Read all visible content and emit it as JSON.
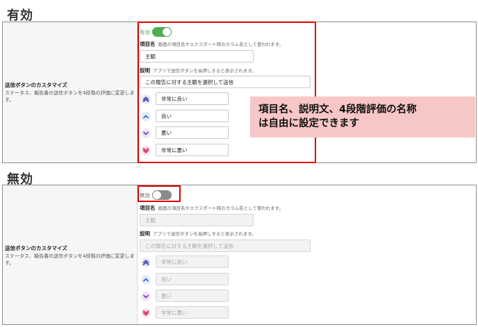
{
  "sections": {
    "enabled": {
      "heading": "有効"
    },
    "disabled": {
      "heading": "無効"
    }
  },
  "setting": {
    "title": "送信ボタンのカスタマイズ",
    "description": "ステータス、報告書の送信ボタンを4段階の評価に変更します。"
  },
  "toggle": {
    "on_label": "有効",
    "off_label": "無効"
  },
  "item_name": {
    "label": "項目名",
    "hint": "画面の項目名やエクスポート時のカラム名として使われます。",
    "value": "主観"
  },
  "explanation": {
    "label": "説明",
    "hint": "アプリで送信ボタンを長押しすると表示されます。",
    "value": "この報告に対する主観を選択して送信"
  },
  "ranks": [
    {
      "icon": "double-chevron-up-icon",
      "label": "非常に良い",
      "color": "#3f4fb0"
    },
    {
      "icon": "chevron-up-icon",
      "label": "良い",
      "color": "#3d63c9"
    },
    {
      "icon": "chevron-down-icon",
      "label": "悪い",
      "color": "#7b3bb3"
    },
    {
      "icon": "double-chevron-down-icon",
      "label": "非常に悪い",
      "color": "#d93162"
    }
  ],
  "callout": {
    "line1": "項目名、説明文、4段階評価の名称",
    "line2": "は自由に設定できます"
  },
  "colors": {
    "accent_green": "#4caf50",
    "toggle_off": "#8a8a8a",
    "highlight_red": "#e00000",
    "callout_bg": "#f7c6c6"
  }
}
